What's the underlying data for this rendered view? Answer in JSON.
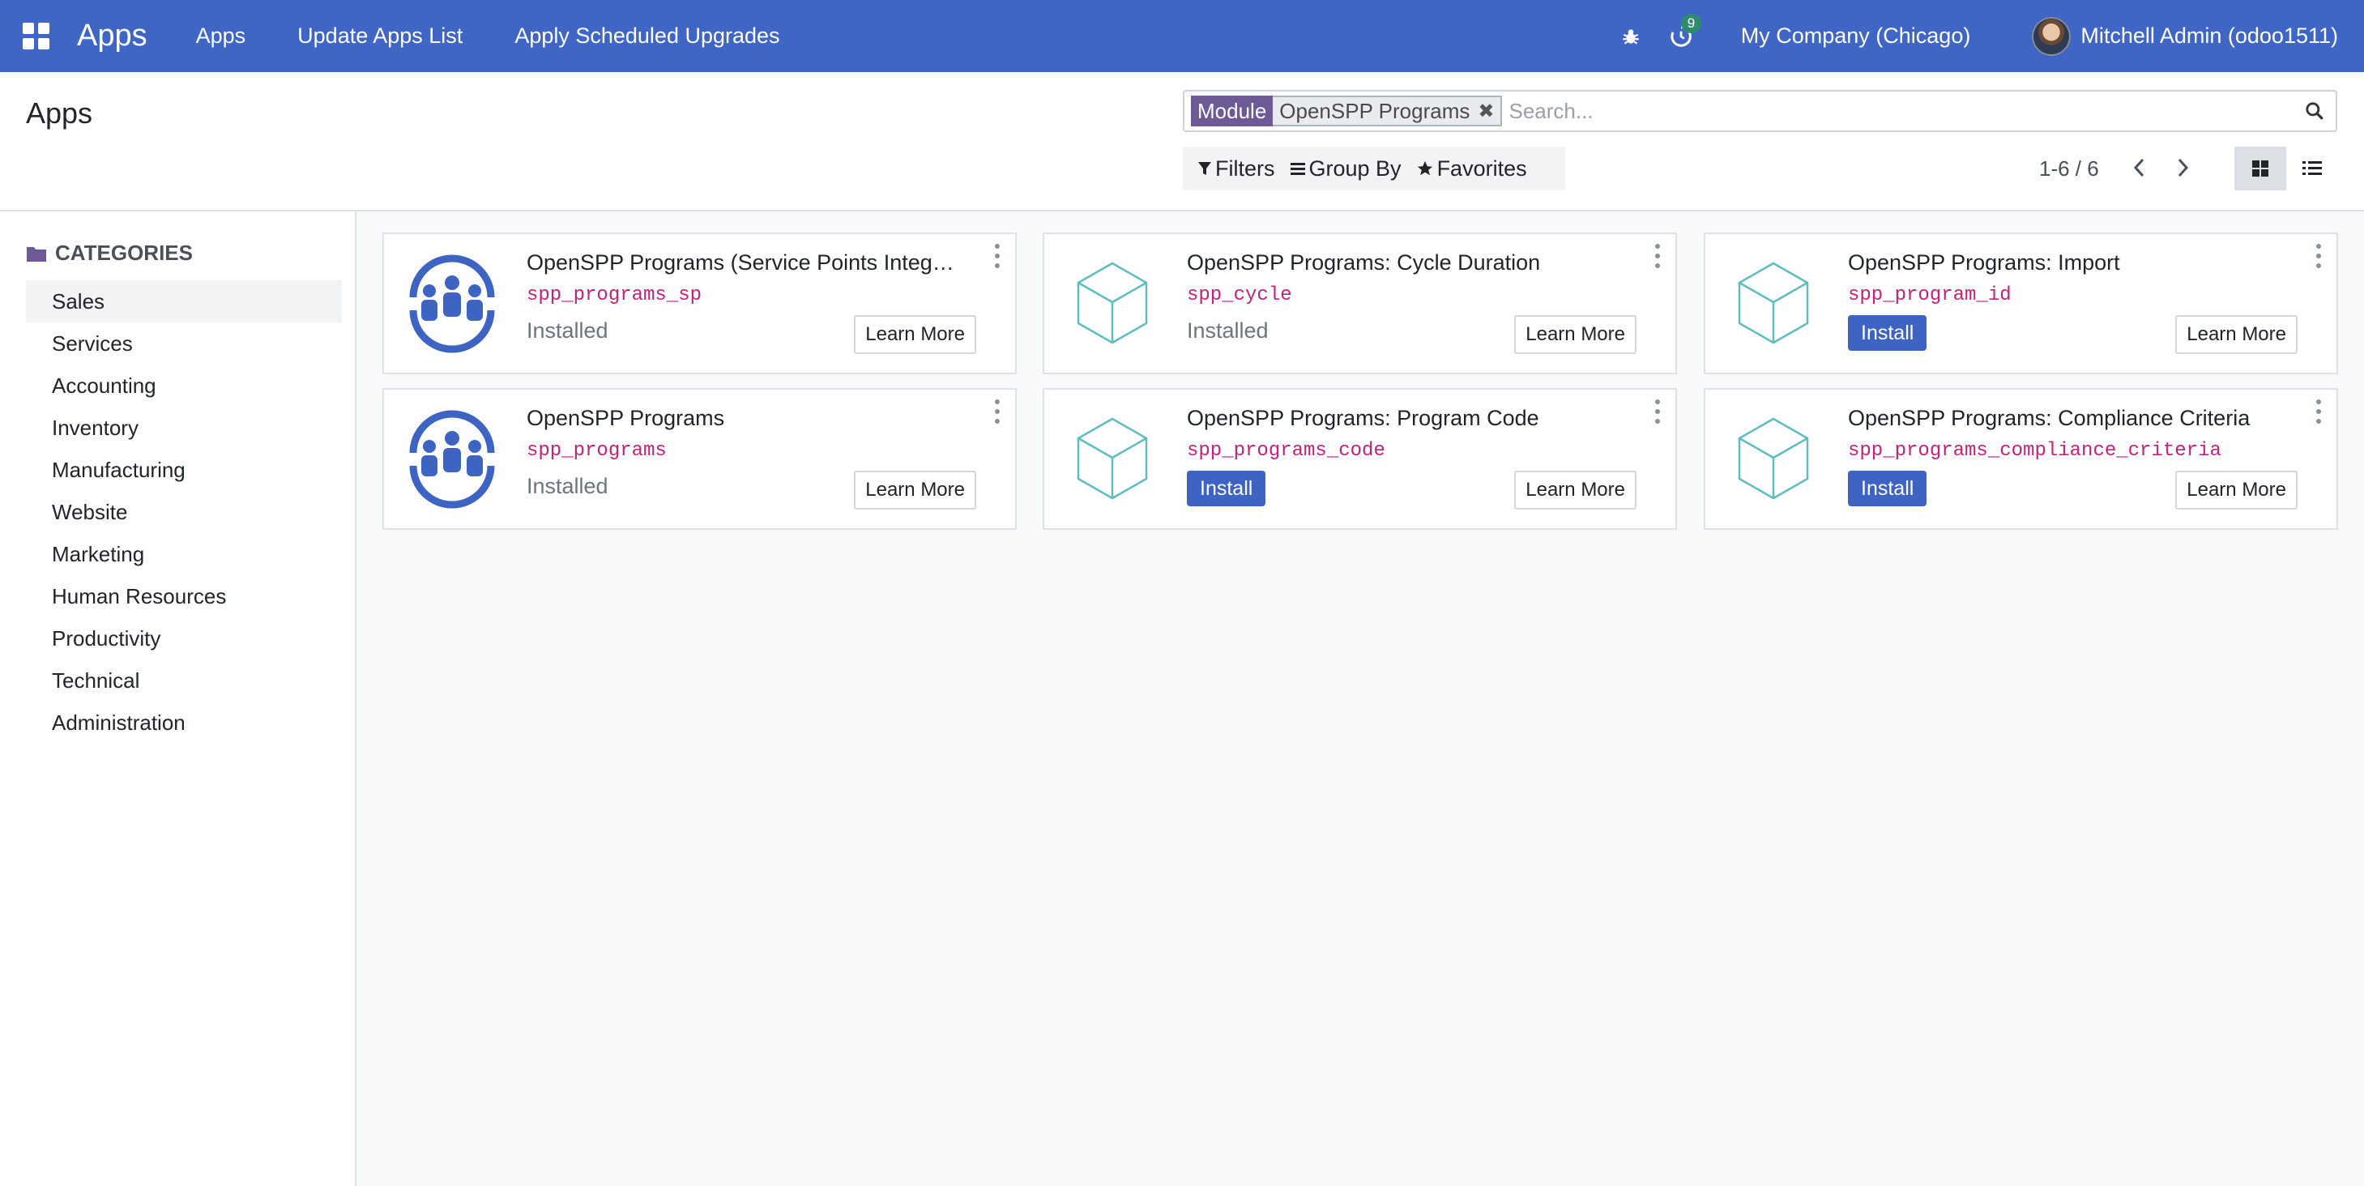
{
  "navbar": {
    "brand": "Apps",
    "menu": [
      "Apps",
      "Update Apps List",
      "Apply Scheduled Upgrades"
    ],
    "activity_count": "9",
    "company": "My Company (Chicago)",
    "user": "Mitchell Admin (odoo1511)"
  },
  "control": {
    "title": "Apps",
    "facet_label": "Module",
    "facet_value": "OpenSPP Programs",
    "search_placeholder": "Search...",
    "filters": "Filters",
    "group_by": "Group By",
    "favorites": "Favorites",
    "pager": "1-6 / 6"
  },
  "sidebar": {
    "header": "CATEGORIES",
    "items": [
      "Sales",
      "Services",
      "Accounting",
      "Inventory",
      "Manufacturing",
      "Website",
      "Marketing",
      "Human Resources",
      "Productivity",
      "Technical",
      "Administration"
    ],
    "active": "Sales"
  },
  "cards": [
    {
      "name": "OpenSPP Programs (Service Points Integ…",
      "tech": "spp_programs_sp",
      "icon": "people-circle-icon",
      "state": "Installed",
      "learn": "Learn More"
    },
    {
      "name": "OpenSPP Programs: Cycle Duration",
      "tech": "spp_cycle",
      "icon": "cube-icon",
      "state": "Installed",
      "learn": "Learn More"
    },
    {
      "name": "OpenSPP Programs: Import",
      "tech": "spp_program_id",
      "icon": "cube-icon",
      "install": "Install",
      "learn": "Learn More"
    },
    {
      "name": "OpenSPP Programs",
      "tech": "spp_programs",
      "icon": "people-circle-icon",
      "state": "Installed",
      "learn": "Learn More"
    },
    {
      "name": "OpenSPP Programs: Program Code",
      "tech": "spp_programs_code",
      "icon": "cube-icon",
      "install": "Install",
      "learn": "Learn More"
    },
    {
      "name": "OpenSPP Programs: Compliance Criteria",
      "tech": "spp_programs_compliance_criteria",
      "icon": "cube-icon",
      "install": "Install",
      "learn": "Learn More"
    }
  ],
  "colors": {
    "navbar": "#4066c5",
    "install_button": "#3d64c2",
    "technical_name": "#c0237a",
    "facet_label": "#6c5a97",
    "cube_stroke": "#5fbcc0"
  }
}
